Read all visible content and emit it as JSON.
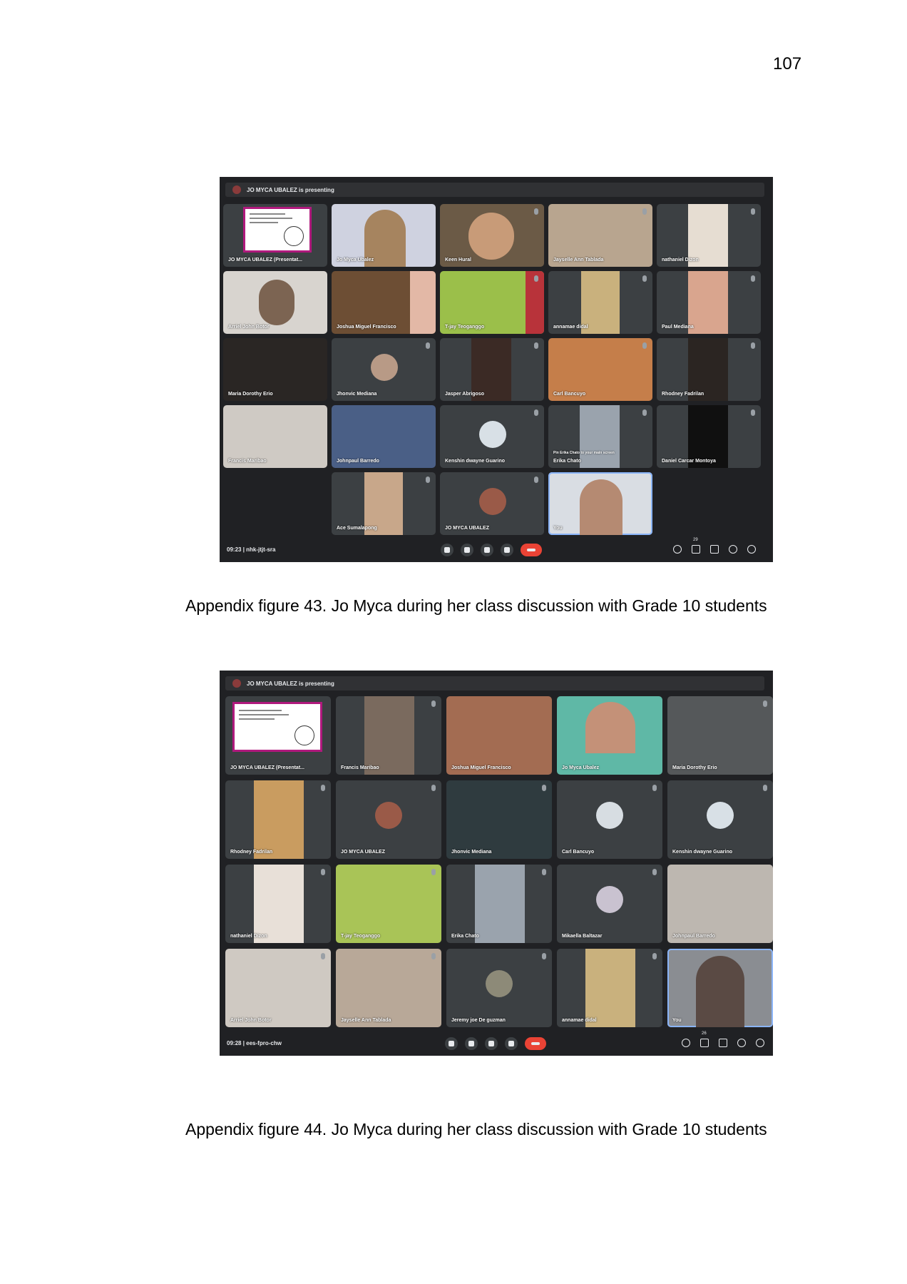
{
  "page_number": "107",
  "figures": [
    {
      "caption": "Appendix figure 43. Jo Myca during her class discussion with Grade 10 students",
      "presenting_label": "JO MYCA UBALEZ is presenting",
      "meeting_time": "09:23",
      "meeting_code": "nhk-jtjt-sra",
      "participants_count": "29",
      "participants": [
        "JO MYCA UBALEZ (Presentat...",
        "Jo Myca Ubalez",
        "Keen Hural",
        "Jayselle Ann Tablada",
        "nathaniel Dizon",
        "Arriel John Botor",
        "Joshua Miguel Francisco",
        "T-jay Teoganggo",
        "annamae didal",
        "Paul Mediana",
        "Maria Dorothy Erio",
        "Jhonvic Mediana",
        "Jasper Abrigoso",
        "Carl Bancuyo",
        "Rhodney Fadrilan",
        "Francis Maribao",
        "Johnpaul Barredo",
        "Kenshin dwayne Guarino",
        "Erika Chato",
        "Daniel Carcar Montoya",
        "Ace Sumalapong",
        "JO MYCA UBALEZ",
        "You"
      ],
      "pin_label": "Pin Erika Chato to your main screen"
    },
    {
      "caption": "Appendix figure 44. Jo Myca during her class discussion with Grade 10 students",
      "presenting_label": "JO MYCA UBALEZ is presenting",
      "meeting_time": "09:28",
      "meeting_code": "ees-fpro-chw",
      "participants_count": "26",
      "participants": [
        "JO MYCA UBALEZ (Presentat...",
        "Francis Maribao",
        "Joshua Miguel Francisco",
        "Jo Myca Ubalez",
        "Maria Dorothy Erio",
        "Rhodney Fadrilan",
        "JO MYCA UBALEZ",
        "Jhonvic Mediana",
        "Carl Bancuyo",
        "Kenshin dwayne Guarino",
        "nathaniel Dizon",
        "T-jay Teoganggo",
        "Erika Chato",
        "Mikaella Baltazar",
        "Johnpaul Barredo",
        "Arriel John Botor",
        "Jayselle Ann Tablada",
        "Jeremy joe De guzman",
        "annamae didal",
        "You"
      ]
    }
  ]
}
